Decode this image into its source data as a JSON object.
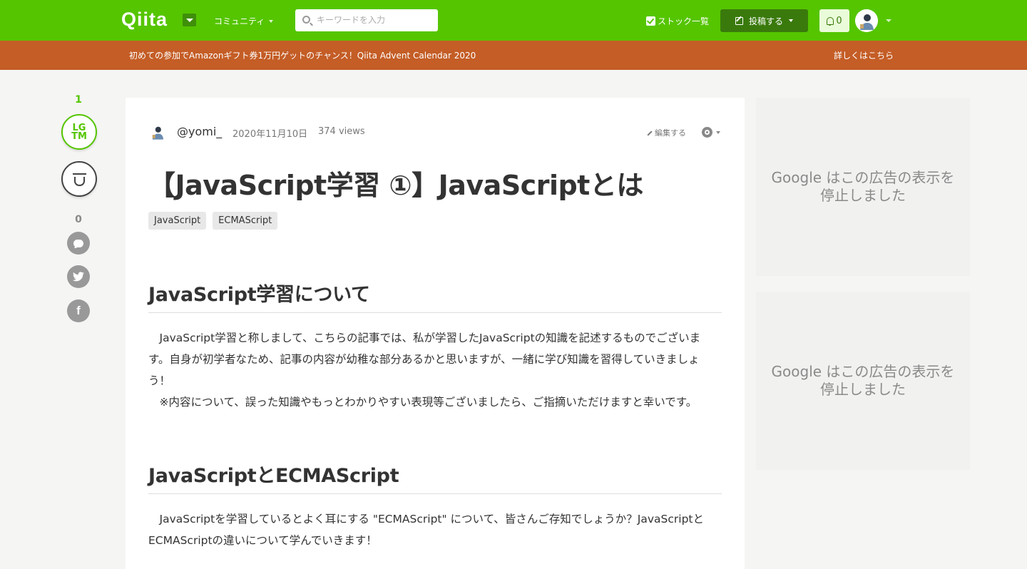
{
  "header": {
    "logo": "Qiita",
    "community_label": "コミュニティ",
    "search_placeholder": "キーワードを入力",
    "stock_list_label": "ストック一覧",
    "post_label": "投稿する",
    "notification_count": "0"
  },
  "banner": {
    "text": "初めての参加でAmazonギフト券1万円ゲットのチャンス！Qiita Advent Calendar 2020",
    "link": "詳しくはこちら"
  },
  "rail": {
    "lgtm_count": "1",
    "lgtm_line1": "LG",
    "lgtm_line2": "TM",
    "comment_count": "0"
  },
  "article": {
    "author": "@yomi_",
    "date": "2020年11月10日",
    "views": "374 views",
    "edit_label": "編集する",
    "title": "【JavaScript学習 ①】JavaScriptとは",
    "tags": [
      "JavaScript",
      "ECMAScript"
    ],
    "section1": {
      "heading": "JavaScript学習について",
      "lines": [
        "　JavaScript学習と称しまして、こちらの記事では、私が学習したJavaScriptの知識を記述するものでございま",
        "す。自身が初学者なため、記事の内容が幼稚な部分あるかと思いますが、一緒に学び知識を習得していきましょ",
        "う！",
        "　※内容について、誤った知識やもっとわかりやすい表現等ございましたら、ご指摘いただけますと幸いです。"
      ]
    },
    "section2": {
      "heading": "JavaScriptとECMAScript",
      "lines": [
        "　JavaScriptを学習しているとよく耳にする \"ECMAScript\" について、皆さんご存知でしょうか？JavaScriptと",
        "ECMAScriptの違いについて学んでいきます！"
      ]
    }
  },
  "ads": {
    "message_line1": "Google はこの広告の表示を",
    "message_line2": "停止しました"
  },
  "colors": {
    "brand_green": "#55c500",
    "banner_orange": "#c45d26"
  }
}
